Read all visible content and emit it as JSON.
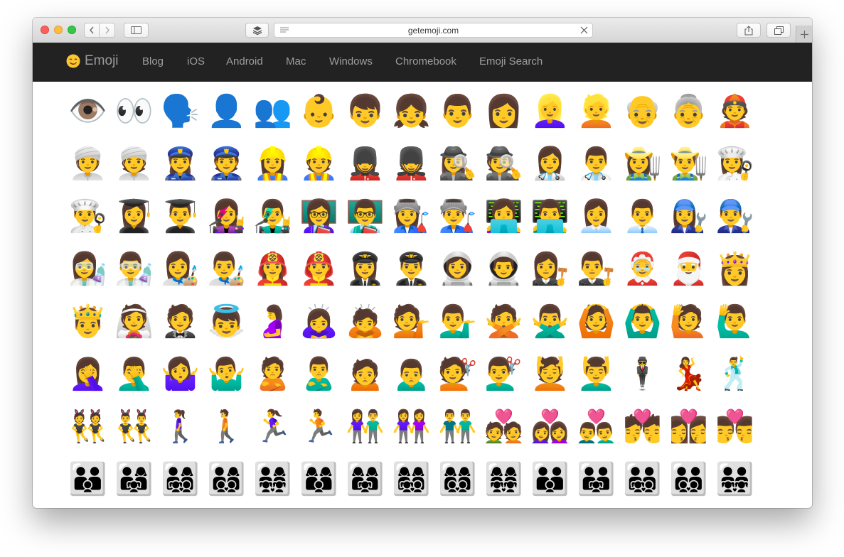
{
  "browser": {
    "url": "getemoji.com",
    "colors": {
      "close": "#fc605c",
      "minimize": "#fdbc40",
      "maximize": "#34c84a"
    }
  },
  "site": {
    "brand": {
      "emoji": "😋",
      "label": "Emoji"
    },
    "nav": [
      "Blog",
      "iOS",
      "Android",
      "Mac",
      "Windows",
      "Chromebook",
      "Emoji Search"
    ],
    "nav_bg": "#222222",
    "nav_fg": "#9d9d9d"
  },
  "emoji_rows": [
    [
      "👁️",
      "👀",
      "🗣️",
      "👤",
      "👥",
      "👶",
      "👦",
      "👧",
      "👨",
      "👩",
      "👱‍♀️",
      "👱",
      "👴",
      "👵",
      "👲"
    ],
    [
      "👳‍♀️",
      "👳",
      "👮‍♀️",
      "👮",
      "👷‍♀️",
      "👷",
      "💂‍♀️",
      "💂",
      "🕵️‍♀️",
      "🕵️",
      "👩‍⚕️",
      "👨‍⚕️",
      "👩‍🌾",
      "👨‍🌾",
      "👩‍🍳"
    ],
    [
      "👨‍🍳",
      "👩‍🎓",
      "👨‍🎓",
      "👩‍🎤",
      "👨‍🎤",
      "👩‍🏫",
      "👨‍🏫",
      "👩‍🏭",
      "👨‍🏭",
      "👩‍💻",
      "👨‍💻",
      "👩‍💼",
      "👨‍💼",
      "👩‍🔧",
      "👨‍🔧"
    ],
    [
      "👩‍🔬",
      "👨‍🔬",
      "👩‍🎨",
      "👨‍🎨",
      "👩‍🚒",
      "👨‍🚒",
      "👩‍✈️",
      "👨‍✈️",
      "👩‍🚀",
      "👨‍🚀",
      "👩‍⚖️",
      "👨‍⚖️",
      "🤶",
      "🎅",
      "👸"
    ],
    [
      "🤴",
      "👰",
      "🤵",
      "👼",
      "🤰",
      "🙇‍♀️",
      "🙇",
      "💁",
      "💁‍♂️",
      "🙅",
      "🙅‍♂️",
      "🙆",
      "🙆‍♂️",
      "🙋",
      "🙋‍♂️"
    ],
    [
      "🤦‍♀️",
      "🤦‍♂️",
      "🤷‍♀️",
      "🤷‍♂️",
      "🙎",
      "🙎‍♂️",
      "🙍",
      "🙍‍♂️",
      "💇",
      "💇‍♂️",
      "💆",
      "💆‍♂️",
      "🕴️",
      "💃",
      "🕺"
    ],
    [
      "👯",
      "👯‍♂️",
      "🚶‍♀️",
      "🚶",
      "🏃‍♀️",
      "🏃",
      "👫",
      "👭",
      "👬",
      "💑",
      "👩‍❤️‍👩",
      "👨‍❤️‍👨",
      "💏",
      "👩‍❤️‍💋‍👩",
      "👨‍❤️‍💋‍👨"
    ],
    [
      "👪",
      "👨‍👩‍👧",
      "👨‍👩‍👧‍👦",
      "👨‍👩‍👦‍👦",
      "👨‍👩‍👧‍👧",
      "👩‍👩‍👦",
      "👩‍👩‍👧",
      "👩‍👩‍👧‍👦",
      "👩‍👩‍👦‍👦",
      "👩‍👩‍👧‍👧",
      "👨‍👨‍👦",
      "👨‍👨‍👧",
      "👨‍👨‍👧‍👦",
      "👨‍👨‍👦‍👦",
      "👨‍👨‍👧‍👧"
    ]
  ]
}
